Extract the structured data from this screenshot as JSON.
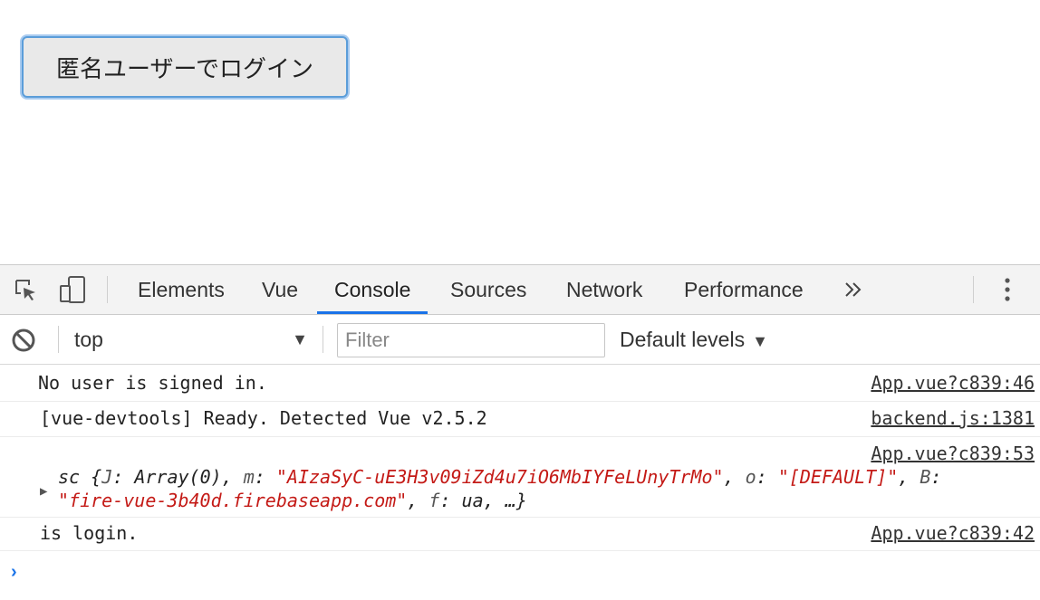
{
  "page": {
    "login_button": "匿名ユーザーでログイン"
  },
  "devtools": {
    "tabs": [
      "Elements",
      "Vue",
      "Console",
      "Sources",
      "Network",
      "Performance"
    ],
    "active_tab": "Console",
    "more_tabs": "»",
    "toolbar": {
      "context": "top",
      "filter_placeholder": "Filter",
      "levels": "Default levels"
    },
    "messages": [
      {
        "text": "No user is signed in.",
        "source": "App.vue?c839:46"
      },
      {
        "text": "[vue-devtools] Ready. Detected Vue v2.5.2",
        "source": "backend.js:1381"
      },
      {
        "source": "App.vue?c839:53",
        "object": {
          "class": "sc",
          "open": "{",
          "k1": "J",
          "v1": "Array(0)",
          "k2": "m",
          "v2": "\"AIzaSyC-uE3H3v09iZd4u7iO6MbIYFeLUnyTrMo\"",
          "k3": "o",
          "v3": "\"[DEFAULT]\"",
          "k4": "B",
          "v4": "\"fire-vue-3b40d.firebaseapp.com\"",
          "k5": "f",
          "v5": "ua",
          "tail": "…}"
        }
      },
      {
        "text": "is login.",
        "source": "App.vue?c839:42"
      }
    ],
    "prompt": "›"
  },
  "colors": {
    "accent": "#1a73e8",
    "string": "#c41a16"
  }
}
